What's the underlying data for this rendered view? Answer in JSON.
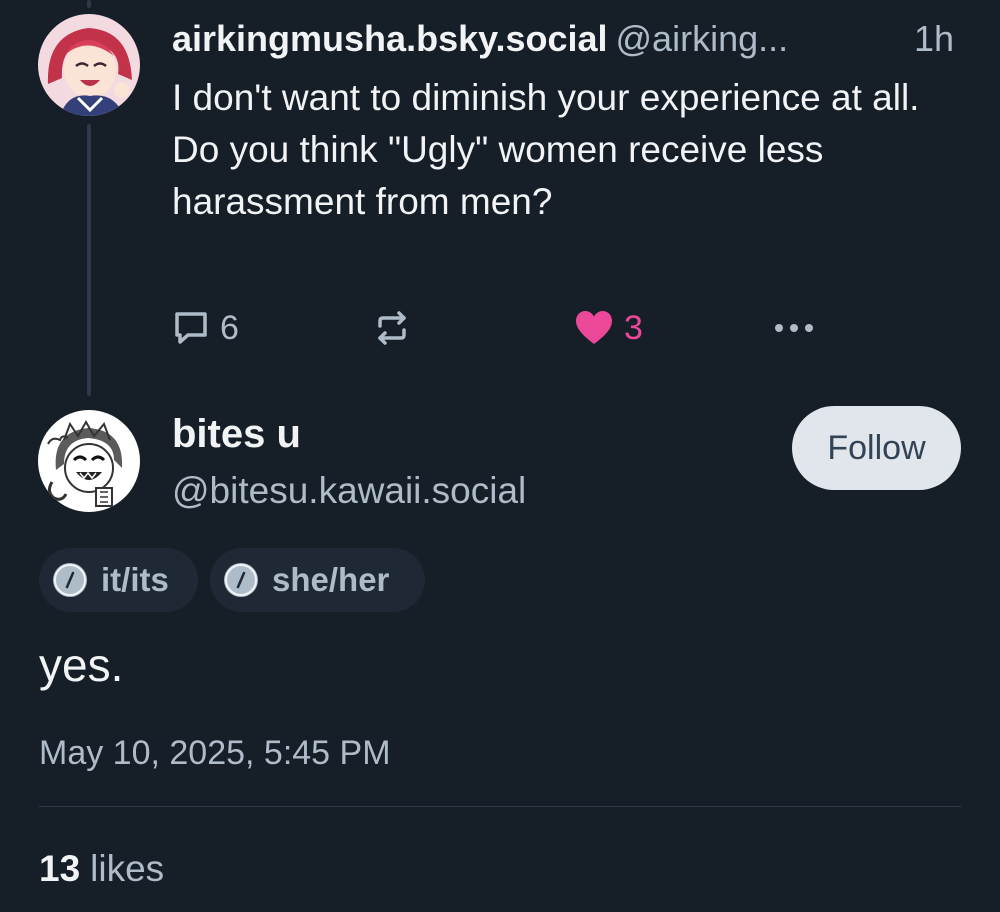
{
  "parent_post": {
    "author_name": "airkingmusha.bsky.social",
    "author_handle": "@airking...",
    "time_ago": "1h",
    "text": "I don't want to diminish your experience at all. Do you think \"Ugly\" women receive less harassment from men?",
    "avatar_icon": "anime-avatar-red-hair",
    "actions": {
      "reply_icon": "comment-icon",
      "reply_count": "6",
      "repost_icon": "repost-icon",
      "like_icon": "heart-icon",
      "like_count": "3",
      "like_color": "#ec4899",
      "more_icon": "more-dots-icon"
    }
  },
  "reply_post": {
    "author_name": "bites u",
    "author_handle": "@bitesu.kawaii.social",
    "avatar_icon": "manga-avatar-sketch",
    "follow_label": "Follow",
    "pronouns": [
      {
        "label": "it/its",
        "icon": "pronoun-slash-icon"
      },
      {
        "label": "she/her",
        "icon": "pronoun-slash-icon"
      }
    ],
    "text": "yes.",
    "timestamp": "May 10, 2025, 5:45 PM",
    "likes_count": "13",
    "likes_label": "likes"
  },
  "colors": {
    "background": "#161e27",
    "text_primary": "#f1f3f5",
    "text_secondary": "#aebbc9",
    "like_pink": "#ec4899",
    "follow_bg": "#e1e6ec"
  }
}
